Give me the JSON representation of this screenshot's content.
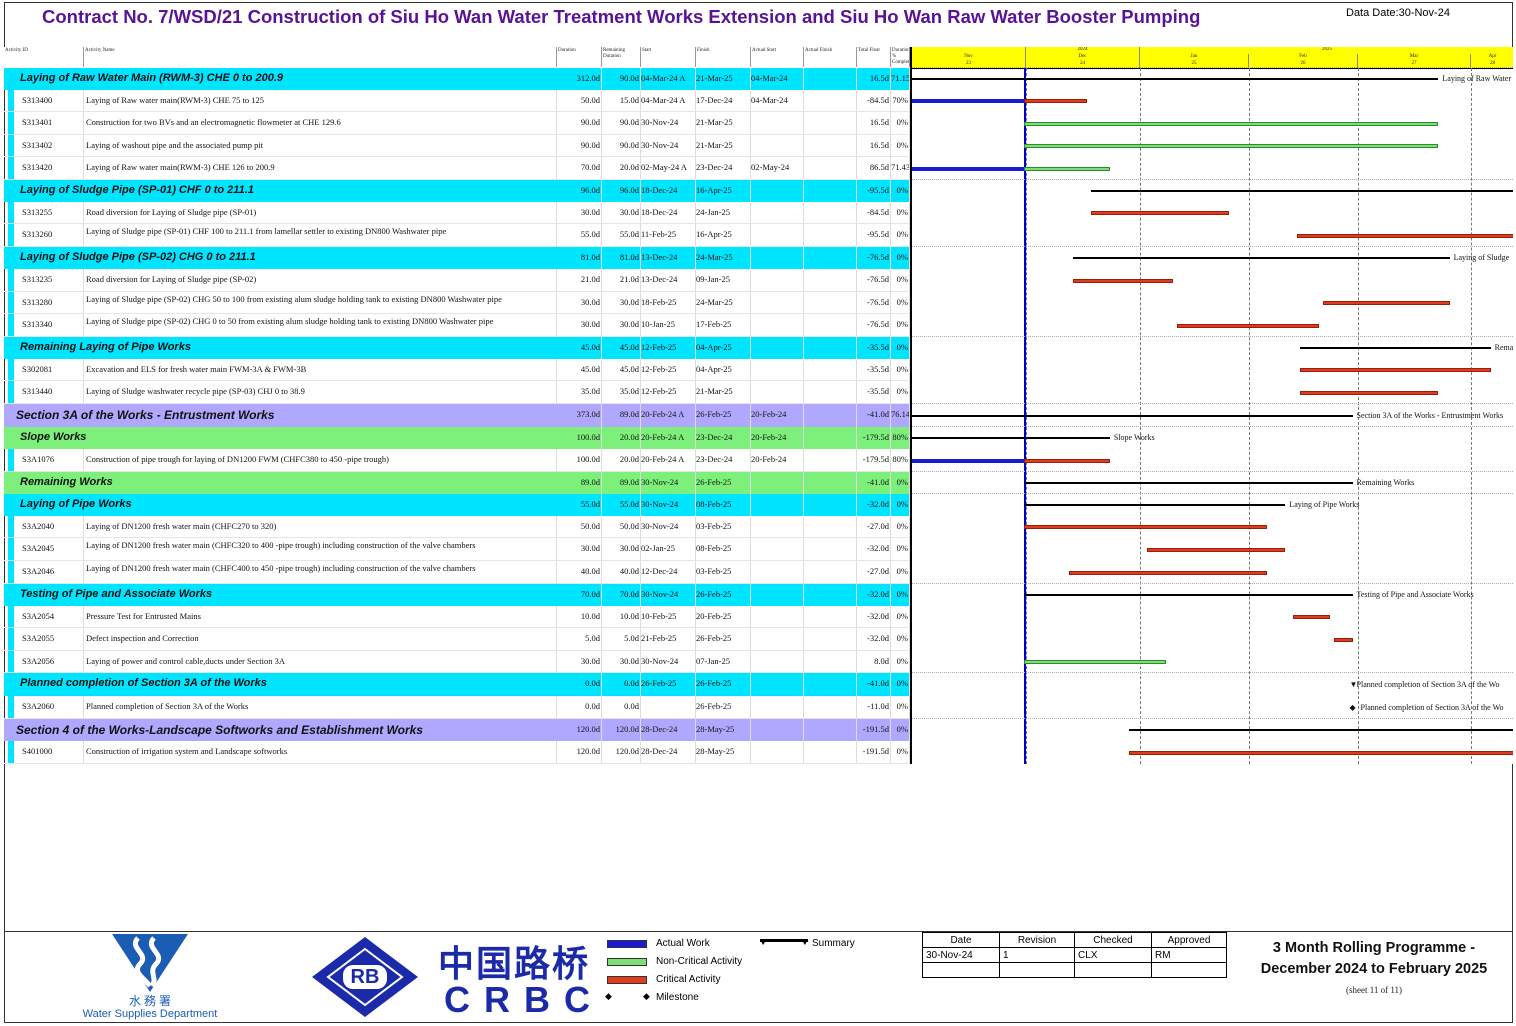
{
  "header": {
    "title": "Contract No. 7/WSD/21 Construction of Siu Ho Wan Water Treatment Works Extension and Siu Ho Wan Raw Water Booster Pumping",
    "data_date": "Data Date:30-Nov-24"
  },
  "columns": [
    "Activity ID",
    "Activity Name",
    "Duration",
    "Remaining Duration",
    "Start",
    "Finish",
    "Actual Start",
    "Actual Finish",
    "Total Float",
    "Duration % Complete"
  ],
  "timeline": {
    "years": [
      "2024",
      "2025"
    ],
    "months": [
      "Nov",
      "Dec",
      "Jan",
      "Feb",
      "Mar",
      "Apr"
    ],
    "weeks": [
      "23",
      "24",
      "25",
      "26",
      "27",
      "28"
    ]
  },
  "rows": [
    {
      "type": "group",
      "color": "#00e5ff",
      "name": "Laying of Raw Water Main (RWM-3) CHE 0  to 200.9",
      "dur": "312.0d",
      "rem": "90.0d",
      "start": "04-Mar-24 A",
      "finish": "21-Mar-25",
      "astart": "04-Mar-24",
      "afinish": "",
      "tf": "16.5d",
      "pct": "71.15%"
    },
    {
      "type": "task",
      "id": "S313400",
      "name": "Laying of Raw water main(RWM-3) CHE 75 to 125",
      "dur": "50.0d",
      "rem": "15.0d",
      "start": "04-Mar-24 A",
      "finish": "17-Dec-24",
      "astart": "04-Mar-24",
      "afinish": "",
      "tf": "-84.5d",
      "pct": "70%"
    },
    {
      "type": "task",
      "id": "S313401",
      "name": "Construction for two BVs and an electromagnetic flowmeter at CHE 129.6",
      "dur": "90.0d",
      "rem": "90.0d",
      "start": "30-Nov-24",
      "finish": "21-Mar-25",
      "astart": "",
      "afinish": "",
      "tf": "16.5d",
      "pct": "0%"
    },
    {
      "type": "task",
      "id": "S313402",
      "name": "Laying of washout pipe and the associated pump pit",
      "dur": "90.0d",
      "rem": "90.0d",
      "start": "30-Nov-24",
      "finish": "21-Mar-25",
      "astart": "",
      "afinish": "",
      "tf": "16.5d",
      "pct": "0%"
    },
    {
      "type": "task",
      "id": "S313420",
      "name": "Laying of Raw water main(RWM-3) CHE 126 to 200.9",
      "dur": "70.0d",
      "rem": "20.0d",
      "start": "02-May-24 A",
      "finish": "23-Dec-24",
      "astart": "02-May-24",
      "afinish": "",
      "tf": "86.5d",
      "pct": "71.43%"
    },
    {
      "type": "group",
      "color": "#00e5ff",
      "name": "Laying of Sludge Pipe (SP-01) CHF 0  to 211.1",
      "dur": "96.0d",
      "rem": "96.0d",
      "start": "18-Dec-24",
      "finish": "16-Apr-25",
      "astart": "",
      "afinish": "",
      "tf": "-95.5d",
      "pct": "0%"
    },
    {
      "type": "task",
      "id": "S313255",
      "name": "Road diversion for Laying of Sludge pipe (SP-01)",
      "dur": "30.0d",
      "rem": "30.0d",
      "start": "18-Dec-24",
      "finish": "24-Jan-25",
      "astart": "",
      "afinish": "",
      "tf": "-84.5d",
      "pct": "0%"
    },
    {
      "type": "task",
      "id": "S313260",
      "name": "Laying of Sludge pipe (SP-01) CHF 100 to 211.1 from lamellar settler to existing DN800 Washwater pipe",
      "dur": "55.0d",
      "rem": "55.0d",
      "start": "11-Feb-25",
      "finish": "16-Apr-25",
      "astart": "",
      "afinish": "",
      "tf": "-95.5d",
      "pct": "0%"
    },
    {
      "type": "group",
      "color": "#00e5ff",
      "name": "Laying of Sludge Pipe (SP-02) CHG 0  to 211.1",
      "dur": "81.0d",
      "rem": "81.0d",
      "start": "13-Dec-24",
      "finish": "24-Mar-25",
      "astart": "",
      "afinish": "",
      "tf": "-76.5d",
      "pct": "0%"
    },
    {
      "type": "task",
      "id": "S313235",
      "name": "Road diversion for Laying of Sludge pipe (SP-02)",
      "dur": "21.0d",
      "rem": "21.0d",
      "start": "13-Dec-24",
      "finish": "09-Jan-25",
      "astart": "",
      "afinish": "",
      "tf": "-76.5d",
      "pct": "0%"
    },
    {
      "type": "task",
      "id": "S313280",
      "name": "Laying of Sludge pipe (SP-02) CHG 50 to 100 from existing alum sludge holding tank to existing DN800 Washwater pipe",
      "dur": "30.0d",
      "rem": "30.0d",
      "start": "18-Feb-25",
      "finish": "24-Mar-25",
      "astart": "",
      "afinish": "",
      "tf": "-76.5d",
      "pct": "0%"
    },
    {
      "type": "task",
      "id": "S313340",
      "name": "Laying of Sludge pipe (SP-02) CHG 0 to 50 from existing alum sludge holding tank to existing DN800 Washwater pipe",
      "dur": "30.0d",
      "rem": "30.0d",
      "start": "10-Jan-25",
      "finish": "17-Feb-25",
      "astart": "",
      "afinish": "",
      "tf": "-76.5d",
      "pct": "0%"
    },
    {
      "type": "group",
      "color": "#00e5ff",
      "name": "Remaining Laying of Pipe Works",
      "dur": "45.0d",
      "rem": "45.0d",
      "start": "12-Feb-25",
      "finish": "04-Apr-25",
      "astart": "",
      "afinish": "",
      "tf": "-35.5d",
      "pct": "0%"
    },
    {
      "type": "task",
      "id": "S302081",
      "name": "Excavation and ELS for fresh water main FWM-3A & FWM-3B",
      "dur": "45.0d",
      "rem": "45.0d",
      "start": "12-Feb-25",
      "finish": "04-Apr-25",
      "astart": "",
      "afinish": "",
      "tf": "-35.5d",
      "pct": "0%"
    },
    {
      "type": "task",
      "id": "S313440",
      "name": "Laying of Sludge washwater recycle pipe (SP-03) CHJ 0 to 38.9",
      "dur": "35.0d",
      "rem": "35.0d",
      "start": "12-Feb-25",
      "finish": "21-Mar-25",
      "astart": "",
      "afinish": "",
      "tf": "-35.5d",
      "pct": "0%"
    },
    {
      "type": "section",
      "color": "#b0a8ff",
      "name": "Section 3A of the Works - Entrustment Works",
      "dur": "373.0d",
      "rem": "89.0d",
      "start": "20-Feb-24 A",
      "finish": "26-Feb-25",
      "astart": "20-Feb-24",
      "afinish": "",
      "tf": "-41.0d",
      "pct": "76.14%"
    },
    {
      "type": "group",
      "color": "#7cf07a",
      "name": "Slope Works",
      "dur": "100.0d",
      "rem": "20.0d",
      "start": "20-Feb-24 A",
      "finish": "23-Dec-24",
      "astart": "20-Feb-24",
      "afinish": "",
      "tf": "-179.5d",
      "pct": "80%"
    },
    {
      "type": "task",
      "id": "S3A1076",
      "name": "Construction of pipe trough for laying of DN1200 FWM (CHFC380 to 450 -pipe trough)",
      "dur": "100.0d",
      "rem": "20.0d",
      "start": "20-Feb-24 A",
      "finish": "23-Dec-24",
      "astart": "20-Feb-24",
      "afinish": "",
      "tf": "-179.5d",
      "pct": "80%"
    },
    {
      "type": "group",
      "color": "#7cf07a",
      "name": "Remaining Works",
      "dur": "89.0d",
      "rem": "89.0d",
      "start": "30-Nov-24",
      "finish": "26-Feb-25",
      "astart": "",
      "afinish": "",
      "tf": "-41.0d",
      "pct": "0%"
    },
    {
      "type": "group",
      "color": "#00e5ff",
      "name": "Laying of Pipe Works",
      "dur": "55.0d",
      "rem": "55.0d",
      "start": "30-Nov-24",
      "finish": "08-Feb-25",
      "astart": "",
      "afinish": "",
      "tf": "-32.0d",
      "pct": "0%"
    },
    {
      "type": "task",
      "id": "S3A2040",
      "name": "Laying of DN1200 fresh water main (CHFC270 to 320)",
      "dur": "50.0d",
      "rem": "50.0d",
      "start": "30-Nov-24",
      "finish": "03-Feb-25",
      "astart": "",
      "afinish": "",
      "tf": "-27.0d",
      "pct": "0%"
    },
    {
      "type": "task",
      "id": "S3A2045",
      "name": "Laying of DN1200 fresh water main (CHFC320 to 400 -pipe trough) including construction of the valve chambers",
      "dur": "30.0d",
      "rem": "30.0d",
      "start": "02-Jan-25",
      "finish": "08-Feb-25",
      "astart": "",
      "afinish": "",
      "tf": "-32.0d",
      "pct": "0%"
    },
    {
      "type": "task",
      "id": "S3A2046",
      "name": "Laying of DN1200 fresh water main (CHFC400 to 450 -pipe trough) including construction of the valve chambers",
      "dur": "40.0d",
      "rem": "40.0d",
      "start": "12-Dec-24",
      "finish": "03-Feb-25",
      "astart": "",
      "afinish": "",
      "tf": "-27.0d",
      "pct": "0%"
    },
    {
      "type": "group",
      "color": "#00e5ff",
      "name": "Testing of Pipe and Associate Works",
      "dur": "70.0d",
      "rem": "70.0d",
      "start": "30-Nov-24",
      "finish": "26-Feb-25",
      "astart": "",
      "afinish": "",
      "tf": "-32.0d",
      "pct": "0%"
    },
    {
      "type": "task",
      "id": "S3A2054",
      "name": "Pressure Test for Entrusted Mains",
      "dur": "10.0d",
      "rem": "10.0d",
      "start": "10-Feb-25",
      "finish": "20-Feb-25",
      "astart": "",
      "afinish": "",
      "tf": "-32.0d",
      "pct": "0%"
    },
    {
      "type": "task",
      "id": "S3A2055",
      "name": "Defect inspection and Correction",
      "dur": "5.0d",
      "rem": "5.0d",
      "start": "21-Feb-25",
      "finish": "26-Feb-25",
      "astart": "",
      "afinish": "",
      "tf": "-32.0d",
      "pct": "0%"
    },
    {
      "type": "task",
      "id": "S3A2056",
      "name": "Laying of power and control cable,ducts under Section 3A",
      "dur": "30.0d",
      "rem": "30.0d",
      "start": "30-Nov-24",
      "finish": "07-Jan-25",
      "astart": "",
      "afinish": "",
      "tf": "8.0d",
      "pct": "0%"
    },
    {
      "type": "group",
      "color": "#00e5ff",
      "name": "Planned completion of Section 3A of the Works",
      "dur": "0.0d",
      "rem": "0.0d",
      "start": "26-Feb-25",
      "finish": "26-Feb-25",
      "astart": "",
      "afinish": "",
      "tf": "-41.0d",
      "pct": "0%"
    },
    {
      "type": "task",
      "id": "S3A2060",
      "name": "Planned completion of Section 3A of the Works",
      "dur": "0.0d",
      "rem": "0.0d",
      "start": "",
      "finish": "26-Feb-25",
      "astart": "",
      "afinish": "",
      "tf": "-11.0d",
      "pct": "0%"
    },
    {
      "type": "section",
      "color": "#b0a8ff",
      "name": "Section 4 of the Works-Landscape Softworks and Establishment Works",
      "dur": "120.0d",
      "rem": "120.0d",
      "start": "28-Dec-24",
      "finish": "28-May-25",
      "astart": "",
      "afinish": "",
      "tf": "-191.5d",
      "pct": "0%"
    },
    {
      "type": "task",
      "id": "S401000",
      "name": "Construction of irrigation system and Landscape softworks",
      "dur": "120.0d",
      "rem": "120.0d",
      "start": "28-Dec-24",
      "finish": "28-May-25",
      "astart": "",
      "afinish": "",
      "tf": "-191.5d",
      "pct": "0%"
    }
  ],
  "gantt_labels": {
    "l0": "Laying of Raw Water",
    "l8": "Laying of Sludge",
    "l12": "Remain",
    "l15": "Section 3A of the Works - Entrustment Works",
    "l16": "Slope Works",
    "l18": "Remaining Works",
    "l19": "Laying of Pipe Works",
    "l23": "Testing of Pipe and Associate Works",
    "l27": "Planned completion of Section 3A of the Wo",
    "l28": "Planned completion of Section 3A of the Wo"
  },
  "legend": {
    "actual": "Actual Work",
    "noncritical": "Non-Critical Activity",
    "critical": "Critical Activity",
    "milestone": "Milestone",
    "summary": "Summary",
    "colors": {
      "actual": "#1a1ad6",
      "noncritical": "#7bde78",
      "critical": "#e03c1e"
    }
  },
  "revision": {
    "headers": [
      "Date",
      "Revision",
      "Checked",
      "Approved"
    ],
    "values": [
      "30-Nov-24",
      "1",
      "CLX",
      "RM"
    ]
  },
  "programme": {
    "line1": "3 Month Rolling Programme -",
    "line2": "December 2024 to February 2025",
    "sheet": "(sheet 11 of 11)"
  },
  "logos": {
    "wsd_chinese": "水 務 署",
    "wsd_english": "Water Supplies Department",
    "rb": "RB",
    "crbc_chinese": "中国路桥",
    "crbc_english": "CRBC"
  }
}
